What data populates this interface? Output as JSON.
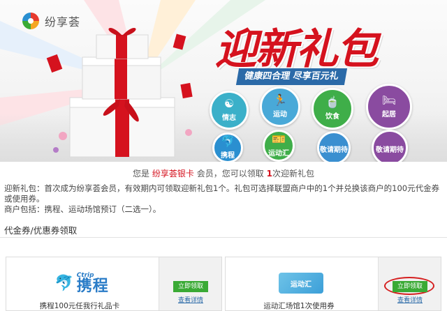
{
  "brand": {
    "name": "纷享荟"
  },
  "hero": {
    "title": "迎新礼包",
    "subtitle": "健康四合理  尽享百元礼"
  },
  "categories": [
    {
      "label": "情志",
      "color": "#3bb0c9"
    },
    {
      "label": "运动",
      "color": "#49a9d8"
    },
    {
      "label": "饮食",
      "color": "#3fae49"
    },
    {
      "label": "起居",
      "color": "#8a4ba0"
    },
    {
      "label": "携程",
      "color": "#2a8fd0"
    },
    {
      "label": "运动汇",
      "color": "#3fae49"
    },
    {
      "label": "敬请期待",
      "color": "#3a8fd0"
    },
    {
      "label": "敬请期待",
      "color": "#8a4ba0"
    }
  ],
  "member": {
    "prefix": "您是",
    "card_name": "纷享荟银卡",
    "middle": "会员，您可以领取",
    "count": "1",
    "suffix": "次迎新礼包"
  },
  "description": {
    "line1": "迎新礼包：首次成为纷享荟会员，有效期内可领取迎新礼包1个。礼包可选择联盟商户中的1个并兑换该商户的100元代金券或使用券。",
    "line2": "商户包括：携程、运动场馆预订（二选一）。"
  },
  "section": {
    "title": "代金券/优惠券领取"
  },
  "coupons": [
    {
      "logo_en": "Ctrip",
      "logo_cn": "携程",
      "label": "携程100元任我行礼品卡",
      "claim": "立即领取",
      "detail": "查看详情"
    },
    {
      "logo_cn": "运动汇",
      "label": "运动汇场馆1次使用券",
      "claim": "立即领取",
      "detail": "查看详情"
    }
  ],
  "colors": {
    "accent_red": "#d5121e",
    "claim_green": "#3aaa35",
    "link_blue": "#2b6aa8"
  }
}
